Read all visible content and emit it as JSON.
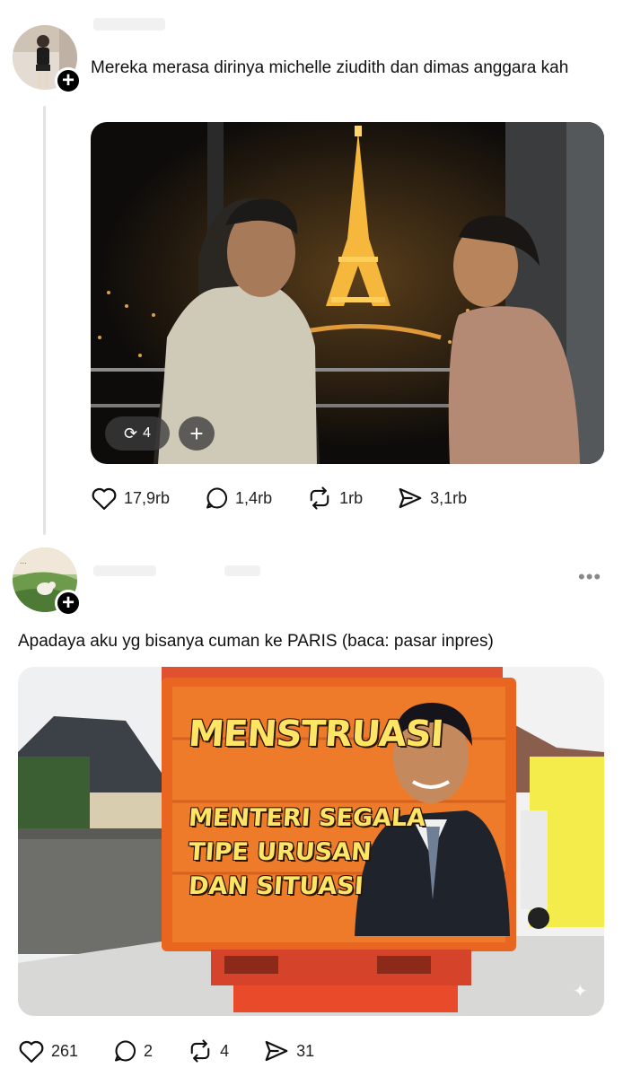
{
  "posts": [
    {
      "text": "Mereka merasa dirinya michelle ziudith dan dimas anggara kah",
      "media": {
        "repost_badge_count": "4",
        "add_button": "+"
      },
      "stats": {
        "likes": "17,9rb",
        "replies": "1,4rb",
        "reposts": "1rb",
        "shares": "3,1rb"
      }
    },
    {
      "text": "Apadaya aku yg bisanya cuman ke PARIS (baca: pasar inpres)",
      "more_icon": "more-icon",
      "media": {
        "truck_title": "MENSTRUASI",
        "truck_line1": "MENTERI SEGALA",
        "truck_line2": "TIPE URUSAN",
        "truck_line3": "DAN SITUASI"
      },
      "stats": {
        "likes": "261",
        "replies": "2",
        "reposts": "4",
        "shares": "31"
      }
    }
  ],
  "icons": {
    "follow": "plus-icon",
    "like": "heart-icon",
    "reply": "comment-icon",
    "repost": "repost-icon",
    "share": "send-icon"
  }
}
